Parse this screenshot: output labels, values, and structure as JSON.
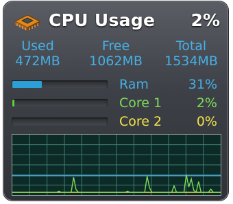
{
  "header": {
    "title": "CPU Usage",
    "percent": "2%",
    "icon": "cpu-chip-icon"
  },
  "memory": {
    "columns": [
      {
        "label": "Used",
        "value": "472MB"
      },
      {
        "label": "Free",
        "value": "1062MB"
      },
      {
        "label": "Total",
        "value": "1534MB"
      }
    ]
  },
  "meters": [
    {
      "label": "Ram",
      "percent": "31%",
      "fraction": 0.31,
      "label_color": "#46b0e6",
      "fill_color": "#2b9fd6"
    },
    {
      "label": "Core 1",
      "percent": "2%",
      "fraction": 0.02,
      "label_color": "#7ddc5a",
      "fill_color": "#5fd13c"
    },
    {
      "label": "Core 2",
      "percent": "0%",
      "fraction": 0.0,
      "label_color": "#f2e24a",
      "fill_color": "#e6d23a"
    }
  ],
  "graph": {
    "core1_color": "#7ddc5a",
    "core2_color": "#f2e24a",
    "ram_color": "#4aa8e0",
    "grid_color": "#3f7f76",
    "core1_history": [
      0,
      0,
      0,
      0,
      0,
      0,
      0,
      0,
      0,
      0,
      0,
      0,
      0,
      0,
      0,
      0,
      0,
      0,
      0,
      2,
      0,
      0,
      0,
      0,
      0,
      28,
      5,
      0,
      0,
      0,
      0,
      0,
      0,
      0,
      0,
      0,
      0,
      0,
      0,
      0,
      0,
      0,
      0,
      0,
      0,
      0,
      0,
      2,
      0,
      0,
      0,
      0,
      0,
      0,
      0,
      30,
      8,
      0,
      0,
      0,
      0,
      0,
      0,
      0,
      0,
      0,
      12,
      0,
      0,
      0,
      0,
      33,
      10,
      25,
      4,
      0,
      20,
      0,
      0,
      0,
      0,
      6,
      0,
      0,
      0,
      0
    ],
    "core2_history": [
      0,
      0,
      0,
      0,
      0,
      0,
      0,
      0,
      0,
      0,
      0,
      0,
      0,
      0,
      0,
      0,
      0,
      0,
      0,
      0,
      0,
      0,
      0,
      0,
      0,
      0,
      0,
      0,
      0,
      0,
      0,
      0,
      0,
      0,
      0,
      0,
      0,
      0,
      0,
      0,
      0,
      0,
      0,
      0,
      0,
      0,
      0,
      0,
      0,
      0,
      0,
      0,
      0,
      0,
      0,
      0,
      0,
      0,
      0,
      0,
      0,
      0,
      0,
      0,
      0,
      0,
      0,
      0,
      0,
      0,
      0,
      0,
      0,
      0,
      0,
      0,
      0,
      0,
      0,
      0,
      0,
      0,
      0,
      0,
      0,
      0
    ],
    "ram_history": [
      31,
      31,
      31,
      31,
      31,
      31,
      31,
      31,
      31,
      31,
      31,
      31,
      31,
      31,
      31,
      31,
      31,
      31,
      31,
      31,
      31,
      31,
      31,
      31,
      31,
      31,
      31,
      31,
      31,
      31,
      31,
      31,
      31,
      31,
      31,
      31,
      31,
      31,
      31,
      31,
      31,
      31,
      31,
      31,
      31,
      31,
      31,
      31,
      31,
      31,
      31,
      31,
      31,
      31,
      31,
      31,
      31,
      31,
      31,
      31,
      31,
      31,
      31,
      31,
      31,
      31,
      31,
      31,
      31,
      31,
      31,
      31,
      31,
      31,
      31,
      31,
      31,
      31,
      31,
      31,
      31,
      31,
      31,
      31,
      31,
      31
    ]
  }
}
